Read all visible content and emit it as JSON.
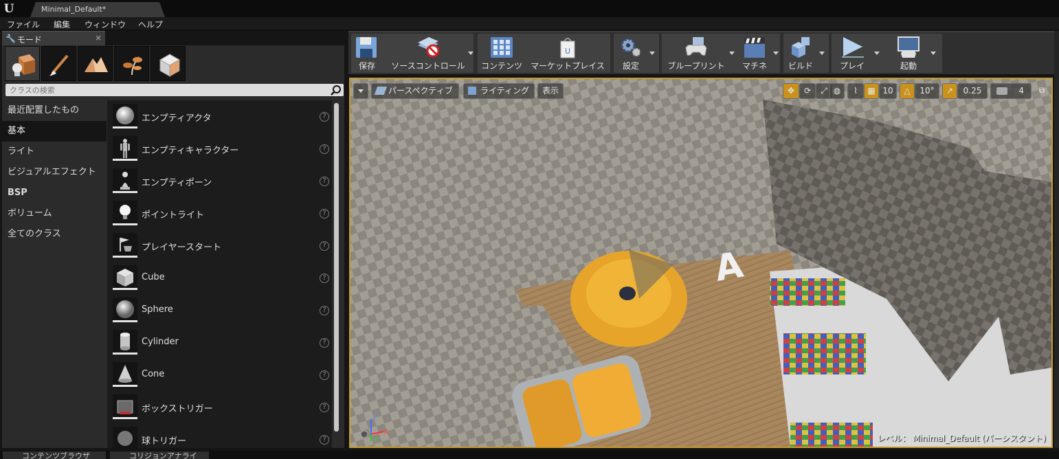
{
  "window": {
    "doc_tab": "Minimal_Default*"
  },
  "menu": [
    "ファイル",
    "編集",
    "ウィンドウ",
    "ヘルプ"
  ],
  "modes_panel": {
    "tab_label": "モード",
    "search_placeholder": "クラスの検索",
    "categories": [
      "最近配置したもの",
      "基本",
      "ライト",
      "ビジュアルエフェクト",
      "BSP",
      "ボリューム",
      "全てのクラス"
    ],
    "selected_category": "基本",
    "items": [
      {
        "label": "エンプティアクタ",
        "icon": "sphere-actor-icon"
      },
      {
        "label": "エンプティキャラクター",
        "icon": "character-icon"
      },
      {
        "label": "エンプティポーン",
        "icon": "pawn-icon"
      },
      {
        "label": "ポイントライト",
        "icon": "lightbulb-icon"
      },
      {
        "label": "プレイヤースタート",
        "icon": "player-start-icon"
      },
      {
        "label": "Cube",
        "icon": "cube-icon"
      },
      {
        "label": "Sphere",
        "icon": "sphere-icon"
      },
      {
        "label": "Cylinder",
        "icon": "cylinder-icon"
      },
      {
        "label": "Cone",
        "icon": "cone-icon"
      },
      {
        "label": "ボックストリガー",
        "icon": "box-trigger-icon"
      },
      {
        "label": "球トリガー",
        "icon": "sphere-trigger-icon"
      }
    ],
    "help_glyph": "?"
  },
  "toolbar": {
    "buttons": [
      {
        "label": "保存",
        "icon": "save-disk-icon"
      },
      {
        "label": "ソースコントロール",
        "icon": "source-control-icon"
      },
      {
        "label": "コンテンツ",
        "icon": "content-grid-icon"
      },
      {
        "label": "マーケットプレイス",
        "icon": "marketplace-bag-icon"
      },
      {
        "label": "設定",
        "icon": "settings-gears-icon"
      },
      {
        "label": "ブループリント",
        "icon": "blueprint-gamepad-icon"
      },
      {
        "label": "マチネ",
        "icon": "matinee-clapper-icon"
      },
      {
        "label": "ビルド",
        "icon": "build-cubes-icon"
      },
      {
        "label": "プレイ",
        "icon": "play-icon"
      },
      {
        "label": "起動",
        "icon": "launch-monitor-icon"
      }
    ]
  },
  "viewport": {
    "perspective_label": "パースペクティブ",
    "lighting_label": "ライティング",
    "show_label": "表示",
    "grid_snap": "10",
    "rotation_snap": "10°",
    "scale_snap": "0.25",
    "camera_speed": "4",
    "level_label": "レベル：  Minimal_Default (パーシスタント)",
    "axis_labels": {
      "z": "Z",
      "x": "X",
      "y": "Y"
    },
    "accent_color": "#c8921c"
  },
  "bottom_tabs": [
    "コンテンツブラウザ",
    "コリジョンアナライ"
  ]
}
